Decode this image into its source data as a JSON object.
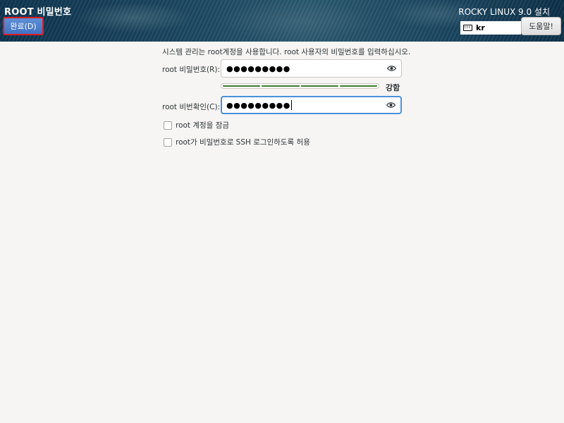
{
  "header": {
    "screen_title": "ROOT 비밀번호",
    "done_button_label": "완료(D)",
    "installer_title": "ROCKY LINUX 9.0 설치",
    "keyboard_layout": "kr",
    "keyboard_icon": "keyboard-icon",
    "help_button_label": "도움말!"
  },
  "form": {
    "instructions": "시스템 관리는 root계정을 사용합니다. root 사용자의 비밀번호를 입력하십시오.",
    "password_label": "root 비밀번호(R):",
    "password_value": "●●●●●●●●●",
    "confirm_label": "root 비번확인(C):",
    "confirm_value": "●●●●●●●●●",
    "reveal_icon": "eye-icon",
    "strength": {
      "segments_total": 4,
      "segments_filled": 4,
      "label": "강함",
      "color": "#3b7a2e"
    },
    "lock_root_label": "root 계정을 잠금",
    "lock_root_checked": false,
    "allow_ssh_label": "root가 비밀번호로 SSH 로그인하도록 허용",
    "allow_ssh_checked": false
  },
  "colors": {
    "done_button": "#4a7fcf",
    "highlight_border": "#e01b24",
    "focus_border": "#4a90d9",
    "background": "#f6f5f4"
  }
}
